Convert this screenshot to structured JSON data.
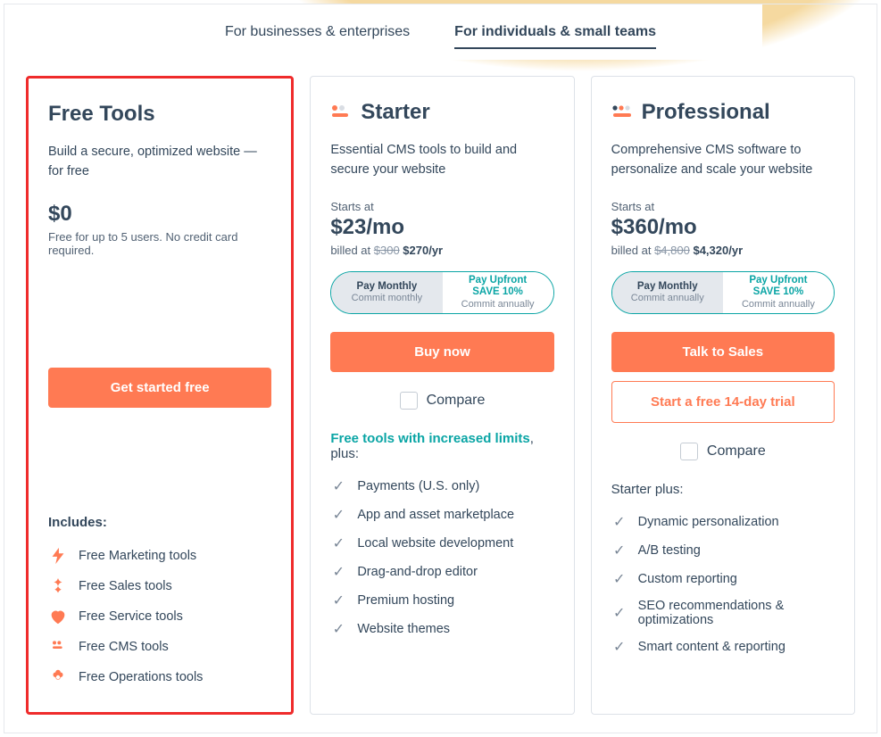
{
  "tabs": {
    "business": "For businesses & enterprises",
    "individuals": "For individuals & small teams"
  },
  "compare_label": "Compare",
  "plans": {
    "free": {
      "title": "Free Tools",
      "desc": "Build a secure, optimized website — for free",
      "price": "$0",
      "price_note": "Free for up to 5 users. No credit card required.",
      "cta_primary": "Get started free",
      "includes_header": "Includes:",
      "features": [
        "Free Marketing tools",
        "Free Sales tools",
        "Free Service tools",
        "Free CMS tools",
        "Free Operations tools"
      ]
    },
    "starter": {
      "title": "Starter",
      "desc": "Essential CMS tools to build and secure your website",
      "starts_at": "Starts at",
      "price": "$23/mo",
      "billed_prefix": "billed at ",
      "billed_strike": "$300",
      "billed_strong": "$270/yr",
      "toggle": {
        "left_title": "Pay Monthly",
        "left_sub": "Commit monthly",
        "right_title": "Pay Upfront",
        "right_save": "SAVE 10%",
        "right_sub": "Commit annually"
      },
      "cta_primary": "Buy now",
      "includes_header": "Free tools with increased limits",
      "includes_suffix": ", plus:",
      "features": [
        "Payments (U.S. only)",
        "App and asset marketplace",
        "Local website development",
        "Drag-and-drop editor",
        "Premium hosting",
        "Website themes"
      ]
    },
    "professional": {
      "title": "Professional",
      "desc": "Comprehensive CMS software to personalize and scale your website",
      "starts_at": "Starts at",
      "price": "$360/mo",
      "billed_prefix": "billed at ",
      "billed_strike": "$4,800",
      "billed_strong": "$4,320/yr",
      "toggle": {
        "left_title": "Pay Monthly",
        "left_sub": "Commit annually",
        "right_title": "Pay Upfront",
        "right_save": "SAVE 10%",
        "right_sub": "Commit annually"
      },
      "cta_primary": "Talk to Sales",
      "cta_secondary": "Start a free 14-day trial",
      "includes_header": "Starter plus:",
      "features": [
        "Dynamic personalization",
        "A/B testing",
        "Custom reporting",
        "SEO recommendations & optimizations",
        "Smart content & reporting"
      ]
    }
  }
}
